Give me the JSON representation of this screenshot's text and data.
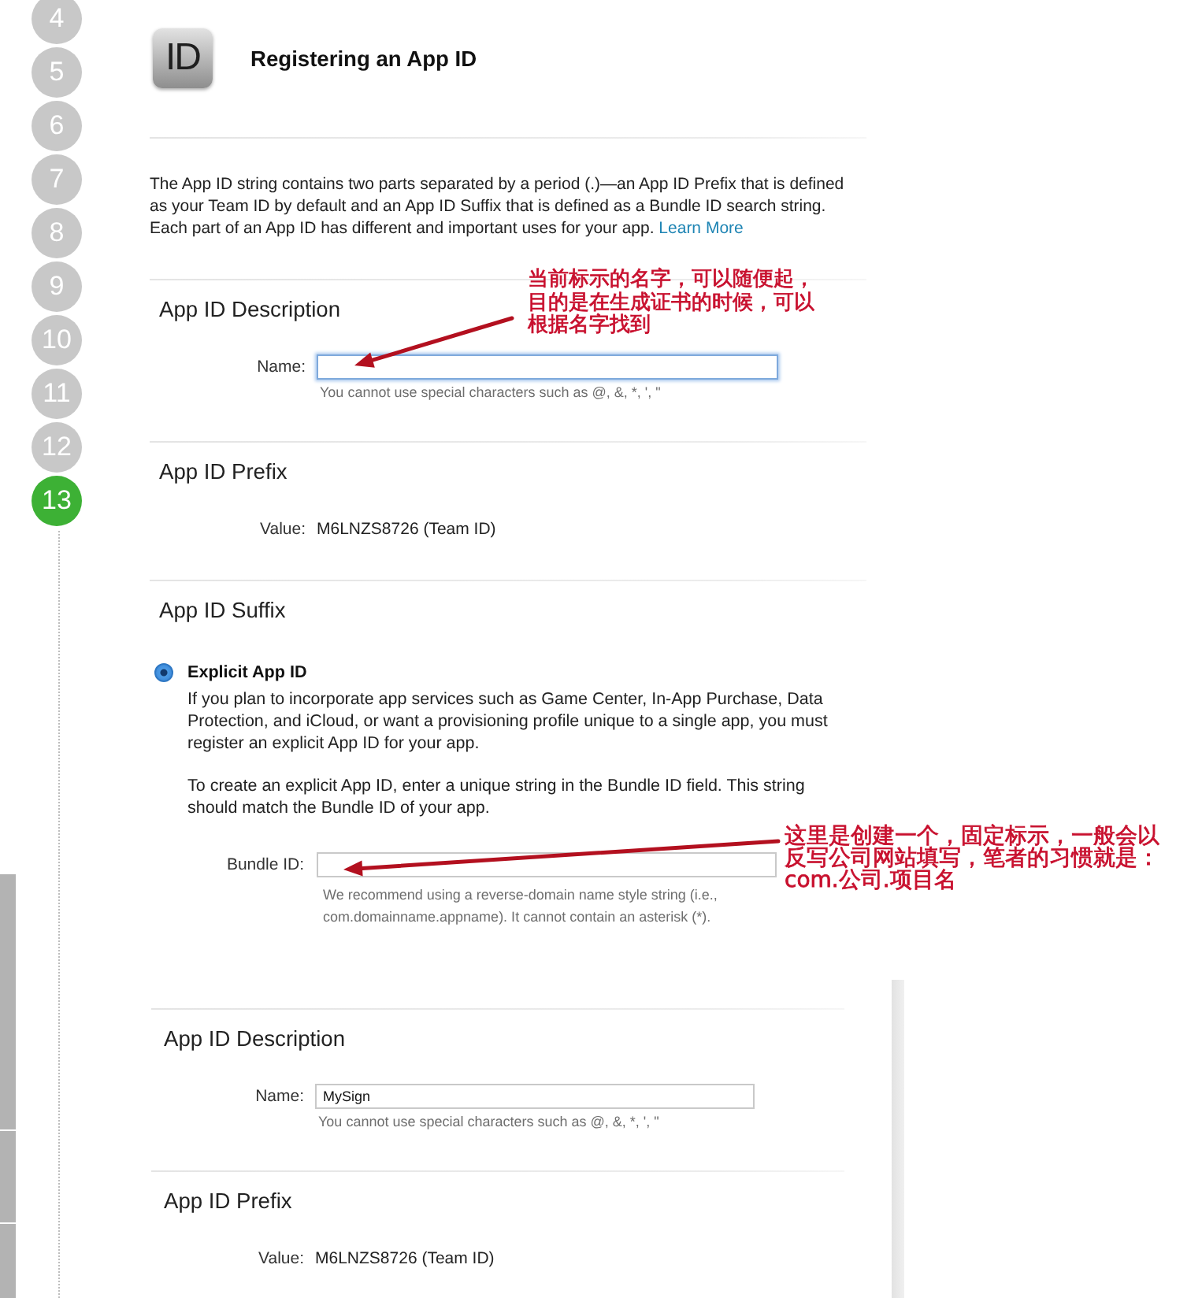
{
  "steps": [
    {
      "label": "4",
      "selected": false
    },
    {
      "label": "5",
      "selected": false
    },
    {
      "label": "6",
      "selected": false
    },
    {
      "label": "7",
      "selected": false
    },
    {
      "label": "8",
      "selected": false
    },
    {
      "label": "9",
      "selected": false
    },
    {
      "label": "10",
      "selected": false
    },
    {
      "label": "11",
      "selected": false
    },
    {
      "label": "12",
      "selected": false
    },
    {
      "label": "13",
      "selected": true
    }
  ],
  "header": {
    "logo": "ID",
    "title": "Registering an App ID"
  },
  "intro": {
    "text": "The App ID string contains two parts separated by a period (.)—an App ID Prefix that is defined as your Team ID by default and an App ID Suffix that is defined as a Bundle ID search string. Each part of an App ID has different and important uses for your app.",
    "link": "Learn More"
  },
  "panels": [
    {
      "sections": [
        {
          "heading": "App ID Description",
          "items": [
            {
              "kind": "input",
              "label": "Name:",
              "focused": true,
              "hint": "You cannot use special characters such as @, &, *, ', \""
            }
          ]
        },
        {
          "heading": "App ID Prefix",
          "items": [
            {
              "kind": "value",
              "label": "Value:",
              "value": "M6LNZS8726 (Team ID)"
            }
          ]
        },
        {
          "heading": "App ID Suffix",
          "items": [
            {
              "kind": "option",
              "label": "Explicit App ID",
              "selected": true,
              "paragraphs": [
                "If you plan to incorporate app services such as Game Center, In-App Purchase, Data Protection, and iCloud, or want a provisioning profile unique to a single app, you must register an explicit App ID for your app.",
                "To create an explicit App ID, enter a unique string in the Bundle ID field. This string should match the Bundle ID of your app."
              ],
              "field": {
                "label": "Bundle ID:",
                "focused": false,
                "hint": "We recommend using a reverse-domain name style string (i.e., com.domainname.appname). It cannot contain an asterisk (*)."
              }
            }
          ]
        }
      ]
    },
    {
      "sections": [
        {
          "heading": "App ID Description",
          "items": [
            {
              "kind": "input",
              "label": "Name:",
              "value": "MySign",
              "focused": false,
              "hint": "You cannot use special characters such as @, &, *, ', \""
            }
          ]
        },
        {
          "heading": "App ID Prefix",
          "items": [
            {
              "kind": "value",
              "label": "Value:",
              "value": "M6LNZS8726 (Team ID)"
            }
          ]
        }
      ]
    }
  ],
  "annotations": [
    {
      "text": "当前标示的名字，可以随便起，目的是在生成证书的时候，可以根据名字找到"
    },
    {
      "text": "这里是创建一个，固定标示，一般会以反写公司网站填写，笔者的习惯就是：com.公司.项目名"
    }
  ]
}
